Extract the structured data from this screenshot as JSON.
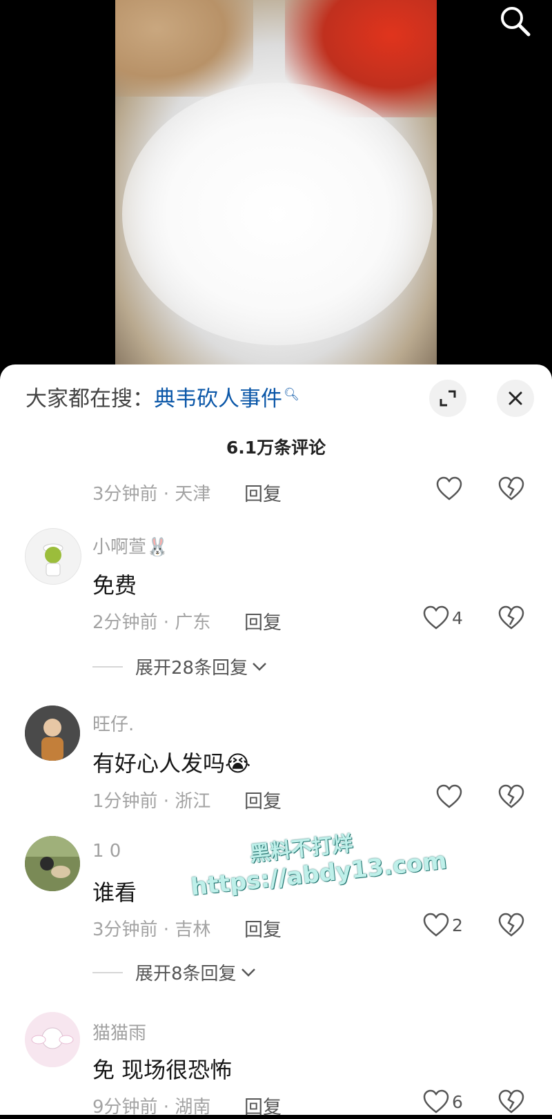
{
  "header": {
    "hot_search_prefix": "大家都在搜：",
    "hot_search_term": "典韦砍人事件",
    "comment_count": "6.1万条评论"
  },
  "comments": [
    {
      "meta": "3分钟前 · 天津",
      "reply": "回复",
      "likes": ""
    },
    {
      "name": "小啊萱🐰",
      "text": "免费",
      "meta": "2分钟前 · 广东",
      "reply": "回复",
      "likes": "4",
      "expand": "展开28条回复"
    },
    {
      "name": "旺仔.",
      "text": "有好心人发吗😭",
      "meta": "1分钟前 · 浙江",
      "reply": "回复",
      "likes": ""
    },
    {
      "name": "1 0",
      "text": "谁看",
      "meta": "3分钟前 · 吉林",
      "reply": "回复",
      "likes": "2",
      "expand": "展开8条回复"
    },
    {
      "name": "猫猫雨",
      "text": "免 现场很恐怖",
      "meta": "9分钟前 · 湖南",
      "reply": "回复",
      "likes": "6"
    }
  ],
  "watermark": {
    "line1": "黑料不打烊",
    "line2": "https://abdy13.com"
  },
  "icons": {
    "search": "search-icon",
    "expand": "expand-icon",
    "close": "close-icon",
    "like": "heart-icon",
    "dislike": "broken-heart-icon",
    "chevron": "chevron-down-icon"
  },
  "colors": {
    "link": "#0b57a8",
    "sheet": "#ffffff"
  }
}
